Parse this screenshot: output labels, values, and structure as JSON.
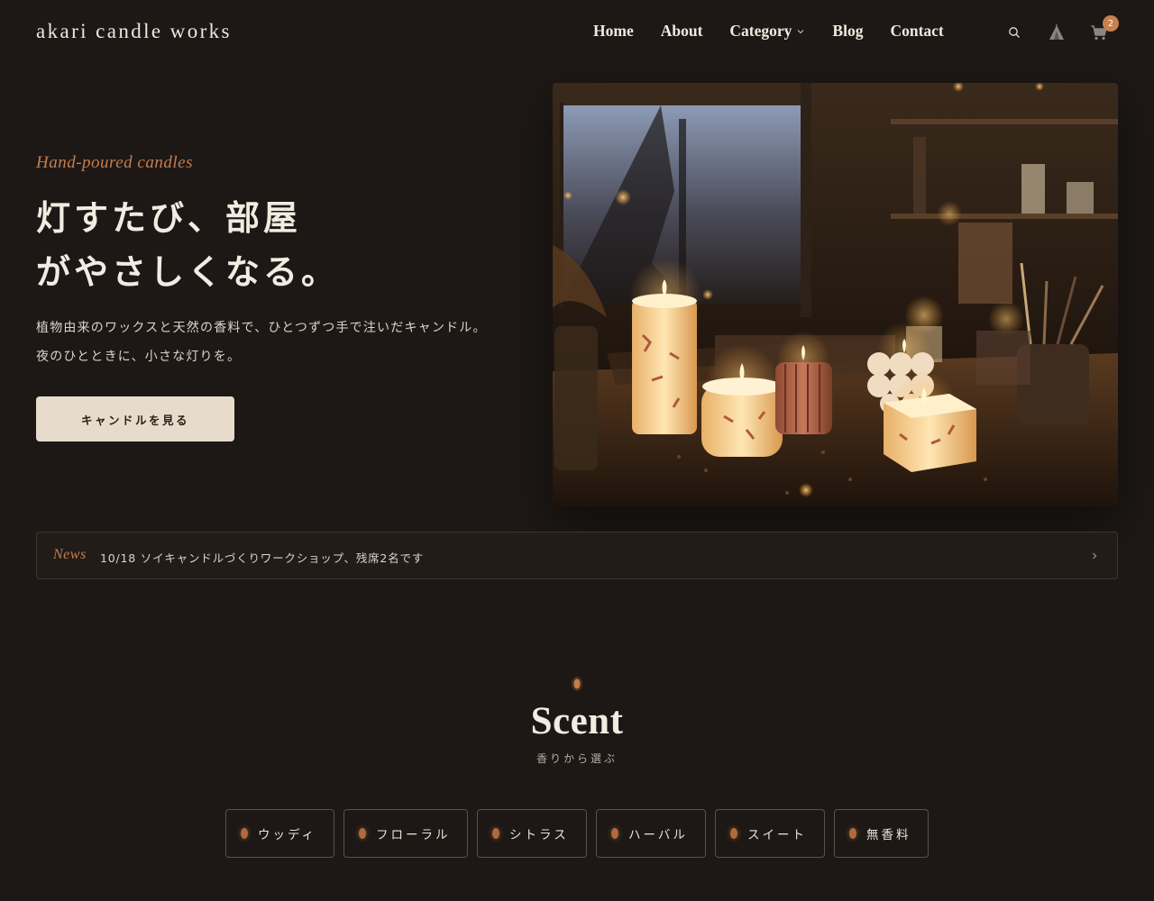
{
  "brand": {
    "logo": "akari candle works"
  },
  "nav": {
    "items": [
      {
        "label": "Home"
      },
      {
        "label": "About"
      },
      {
        "label": "Category"
      },
      {
        "label": "Blog"
      },
      {
        "label": "Contact"
      }
    ]
  },
  "header_icons": {
    "search": "search-icon",
    "tent": "tent-icon",
    "cart": "cart-icon",
    "cart_count": "2"
  },
  "hero": {
    "eyebrow": "Hand-poured candles",
    "title_line1": "灯すたび、部屋",
    "title_line2": "がやさしくなる。",
    "description": "植物由来のワックスと天然の香料で、ひとつずつ手で注いだキャンドル。夜のひとときに、小さな灯りを。",
    "cta_label": "キャンドルを見る"
  },
  "news": {
    "label": "News",
    "text": "10/18 ソイキャンドルづくりワークショップ、残席2名です"
  },
  "scent": {
    "title": "Scent",
    "subtitle": "香りから選ぶ",
    "chips": [
      {
        "label": "ウッディ"
      },
      {
        "label": "フローラル"
      },
      {
        "label": "シトラス"
      },
      {
        "label": "ハーバル"
      },
      {
        "label": "スイート"
      },
      {
        "label": "無香料"
      }
    ]
  },
  "colors": {
    "background": "#1d1816",
    "accent": "#c77d4d",
    "cta_bg": "#e7dccb",
    "text": "#f2ebe1"
  }
}
